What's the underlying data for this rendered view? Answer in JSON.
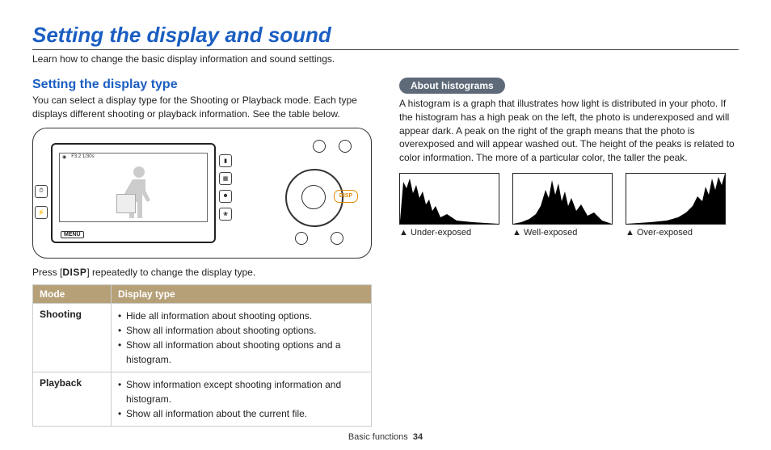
{
  "title": "Setting the display and sound",
  "intro": "Learn how to change the basic display information and sound settings.",
  "left": {
    "heading": "Setting the display type",
    "para": "You can select a display type for the Shooting or Playback mode. Each type displays different shooting or playback information. See the table below.",
    "press_pre": "Press [",
    "press_disp": "DISP",
    "press_post": "] repeatedly to change the display type.",
    "camera": {
      "menu": "MENU",
      "disp": "DISP",
      "status": "F3.2  1/30s"
    }
  },
  "table": {
    "th_mode": "Mode",
    "th_type": "Display type",
    "rows": [
      {
        "mode": "Shooting",
        "items": [
          "Hide all information about shooting options.",
          "Show all information about shooting options.",
          "Show all information about shooting options and a histogram."
        ]
      },
      {
        "mode": "Playback",
        "items": [
          "Show information except shooting information and histogram.",
          "Show all information about the current file."
        ]
      }
    ]
  },
  "right": {
    "pill": "About histograms",
    "para": "A histogram is a graph that illustrates how light is distributed in your photo. If the histogram has a high peak on the left, the photo is underexposed and will appear dark. A peak on the right of the graph means that the photo is overexposed and will appear washed out. The height of the peaks is related to color information. The more of a particular color, the taller the peak.",
    "captions": [
      "▲ Under-exposed",
      "▲ Well-exposed",
      "▲ Over-exposed"
    ]
  },
  "footer": {
    "section": "Basic functions",
    "page": "34"
  }
}
